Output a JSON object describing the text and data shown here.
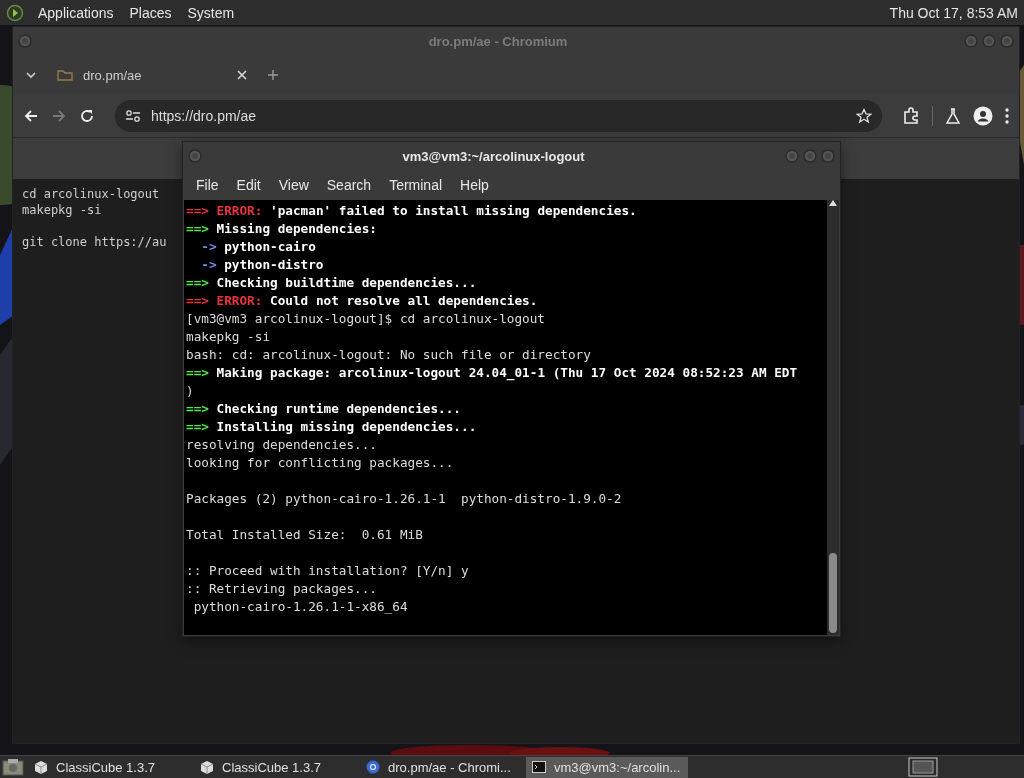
{
  "top_panel": {
    "menus": [
      "Applications",
      "Places",
      "System"
    ],
    "clock": "Thu Oct 17,  8:53 AM"
  },
  "browser": {
    "title": "dro.pm/ae - Chromium",
    "tabs": [
      {
        "label": "dro.pm/ae",
        "selected": true
      }
    ],
    "address": "https://dro.pm/ae",
    "page_lines": [
      {
        "kind": "code",
        "text": "cd arcolinux-logout"
      },
      {
        "kind": "code",
        "text": "makepkg -si"
      },
      {
        "kind": "blank"
      },
      {
        "kind": "code",
        "text": "git clone https://au"
      }
    ]
  },
  "terminal": {
    "title": "vm3@vm3:~/arcolinux-logout",
    "menu": [
      "File",
      "Edit",
      "View",
      "Search",
      "Terminal",
      "Help"
    ],
    "lines": [
      {
        "kind": "error",
        "marker": "==>",
        "label": "ERROR:",
        "text": "'pacman' failed to install missing dependencies."
      },
      {
        "kind": "status",
        "marker": "==>",
        "text": "Missing dependencies:"
      },
      {
        "kind": "dep",
        "marker": "->",
        "text": "python-cairo"
      },
      {
        "kind": "dep",
        "marker": "->",
        "text": "python-distro"
      },
      {
        "kind": "status",
        "marker": "==>",
        "text": "Checking buildtime dependencies..."
      },
      {
        "kind": "error",
        "marker": "==>",
        "label": "ERROR:",
        "text": "Could not resolve all dependencies."
      },
      {
        "kind": "plain",
        "text": "[vm3@vm3 arcolinux-logout]$ cd arcolinux-logout"
      },
      {
        "kind": "plain",
        "text": "makepkg -si"
      },
      {
        "kind": "plain",
        "text": "bash: cd: arcolinux-logout: No such file or directory"
      },
      {
        "kind": "status",
        "marker": "==>",
        "text": "Making package: arcolinux-logout 24.04_01-1 (Thu 17 Oct 2024 08:52:23 AM EDT"
      },
      {
        "kind": "plain",
        "text": ")"
      },
      {
        "kind": "status",
        "marker": "==>",
        "text": "Checking runtime dependencies..."
      },
      {
        "kind": "status",
        "marker": "==>",
        "text": "Installing missing dependencies..."
      },
      {
        "kind": "plain",
        "text": "resolving dependencies..."
      },
      {
        "kind": "plain",
        "text": "looking for conflicting packages..."
      },
      {
        "kind": "blank"
      },
      {
        "kind": "plain",
        "text": "Packages (2) python-cairo-1.26.1-1  python-distro-1.9.0-2"
      },
      {
        "kind": "blank"
      },
      {
        "kind": "plain",
        "text": "Total Installed Size:  0.61 MiB"
      },
      {
        "kind": "blank"
      },
      {
        "kind": "plain",
        "text": ":: Proceed with installation? [Y/n] y"
      },
      {
        "kind": "plain",
        "text": ":: Retrieving packages..."
      },
      {
        "kind": "plain",
        "text": " python-cairo-1.26.1-1-x86_64"
      }
    ]
  },
  "taskbar": {
    "tasks": [
      {
        "kind": "cube",
        "label": "ClassiCube 1.3.7",
        "selected": false
      },
      {
        "kind": "cube",
        "label": "ClassiCube 1.3.7",
        "selected": false
      },
      {
        "kind": "browser",
        "label": "dro.pm/ae - Chromi...",
        "selected": false
      },
      {
        "kind": "terminal",
        "label": "vm3@vm3:~/arcolin...",
        "selected": true
      }
    ]
  }
}
